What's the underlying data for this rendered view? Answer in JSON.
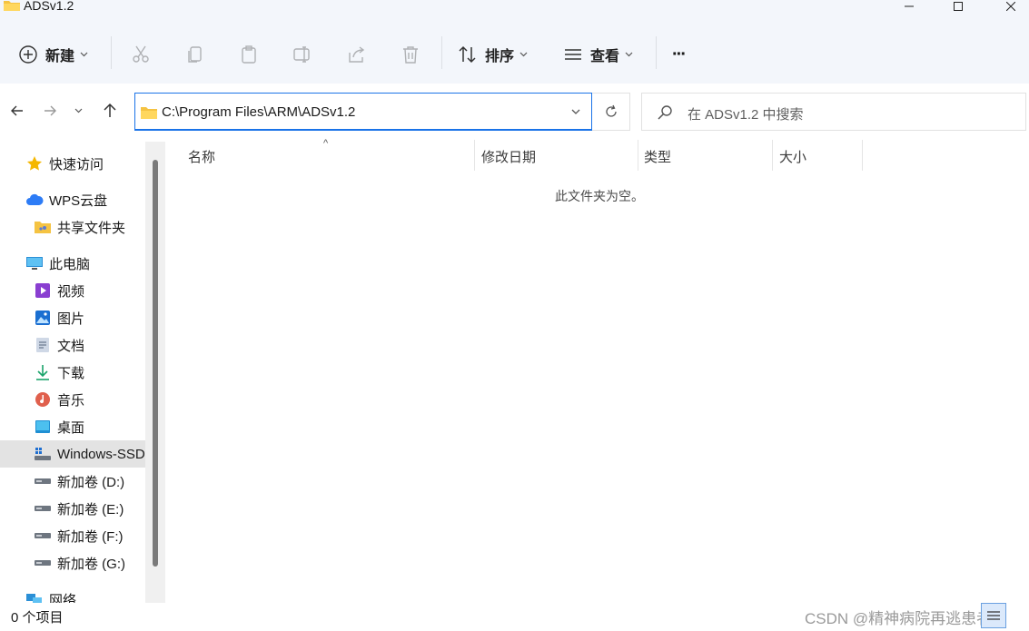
{
  "window": {
    "title": "ADSv1.2"
  },
  "toolbar": {
    "new_label": "新建",
    "sort_label": "排序",
    "view_label": "查看",
    "more_label": "···"
  },
  "address": {
    "path": "C:\\Program Files\\ARM\\ADSv1.2"
  },
  "search": {
    "placeholder": "在 ADSv1.2 中搜索"
  },
  "sidebar": {
    "items": [
      {
        "label": "快速访问",
        "icon": "star-icon"
      },
      {
        "label": "WPS云盘",
        "icon": "cloud-icon"
      },
      {
        "label": "共享文件夹",
        "icon": "shared-folder-icon"
      },
      {
        "label": "此电脑",
        "icon": "computer-icon"
      },
      {
        "label": "视频",
        "icon": "video-icon"
      },
      {
        "label": "图片",
        "icon": "picture-icon"
      },
      {
        "label": "文档",
        "icon": "document-icon"
      },
      {
        "label": "下载",
        "icon": "download-icon"
      },
      {
        "label": "音乐",
        "icon": "music-icon"
      },
      {
        "label": "桌面",
        "icon": "desktop-icon"
      },
      {
        "label": "Windows-SSD",
        "icon": "system-drive-icon"
      },
      {
        "label": "新加卷 (D:)",
        "icon": "drive-icon"
      },
      {
        "label": "新加卷 (E:)",
        "icon": "drive-icon"
      },
      {
        "label": "新加卷 (F:)",
        "icon": "drive-icon"
      },
      {
        "label": "新加卷 (G:)",
        "icon": "drive-icon"
      },
      {
        "label": "网络",
        "icon": "network-icon"
      }
    ]
  },
  "columns": [
    {
      "label": "名称"
    },
    {
      "label": "修改日期"
    },
    {
      "label": "类型"
    },
    {
      "label": "大小"
    }
  ],
  "content": {
    "empty_message": "此文件夹为空。"
  },
  "status": {
    "item_count": "0 个项目"
  },
  "watermark": "CSDN @精神病院再逃患者",
  "colors": {
    "accent": "#1a73e8",
    "folder": "#f5c342",
    "toolbar_bg": "#f3f6fb",
    "selected_bg": "#e3e3e3"
  }
}
